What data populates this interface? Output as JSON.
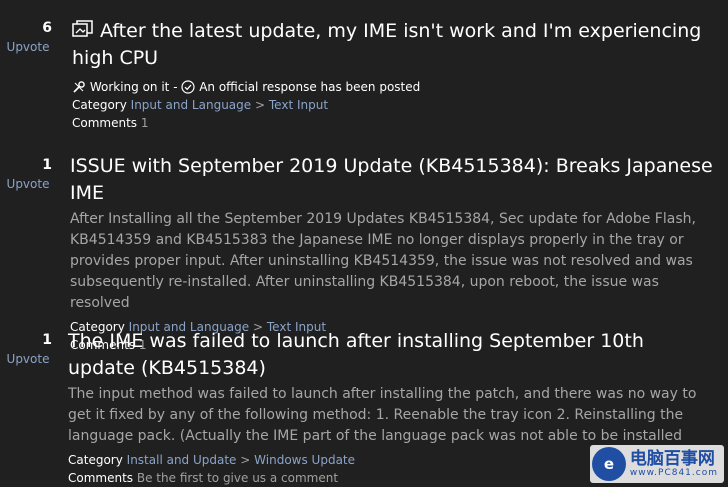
{
  "items": [
    {
      "votes": "6",
      "upvote_label": "Upvote",
      "title": "After the latest update, my IME isn't work and I'm experiencing high CPU",
      "status_working": "Working on it -",
      "status_official": "An official response has been posted",
      "category_label": "Category",
      "category_primary": "Input and Language",
      "category_sep": ">",
      "category_secondary": "Text Input",
      "comments_label": "Comments",
      "comments_value": "1"
    },
    {
      "votes": "1",
      "upvote_label": "Upvote",
      "title": "ISSUE with September 2019 Update (KB4515384): Breaks Japanese IME",
      "description": "After Installing all the September 2019 Updates KB4515384, Sec update for Adobe Flash, KB4514359 and KB4515383 the Japanese IME no longer displays properly in the tray or provides proper input. After uninstalling KB4514359, the issue was not resolved and was subsequently re-installed. After uninstalling KB4515384, upon reboot, the issue was resolved",
      "category_label": "Category",
      "category_primary": "Input and Language",
      "category_sep": ">",
      "category_secondary": "Text Input",
      "comments_label": "Comments",
      "comments_value": "1"
    },
    {
      "votes": "1",
      "upvote_label": "Upvote",
      "title": "The IME was failed to launch after installing September 10th update (KB4515384)",
      "description": "The input method was failed to launch after installing the patch, and there was no way to get it fixed by any of the following method: 1. Reenable the tray icon 2. Reinstalling the language pack. (Actually the IME part of the language pack was not able to be installed",
      "category_label": "Category",
      "category_primary": "Install and Update",
      "category_sep": ">",
      "category_secondary": "Windows Update",
      "comments_label": "Comments",
      "comments_value": "Be the first to give us a comment"
    }
  ],
  "watermark": {
    "main": "电脑百事网",
    "sub": "www.PC841.com"
  },
  "colors": {
    "background": "#202020",
    "link": "#8aa4c8",
    "muted": "#a6a6a6"
  }
}
